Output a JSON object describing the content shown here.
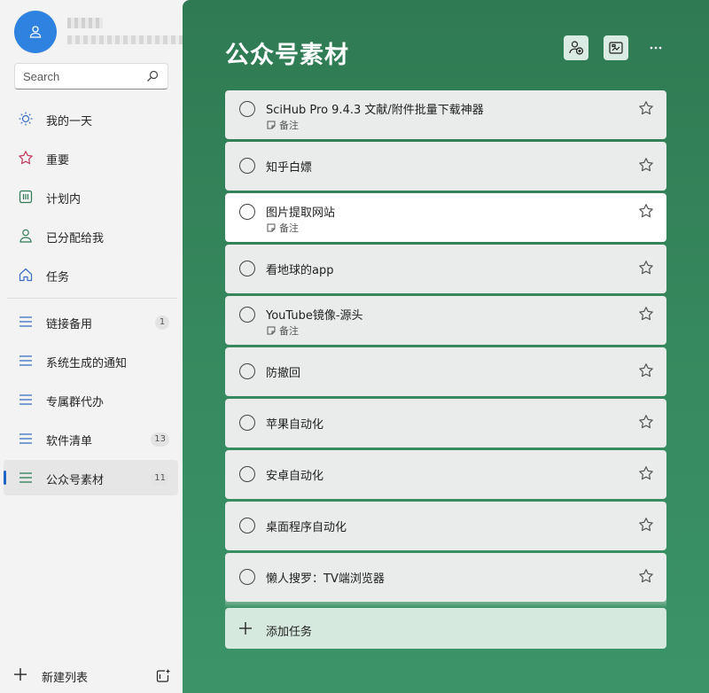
{
  "sidebar": {
    "search_placeholder": "Search",
    "smart_lists": [
      {
        "label": "我的一天",
        "icon": "sun-icon"
      },
      {
        "label": "重要",
        "icon": "star-icon"
      },
      {
        "label": "计划内",
        "icon": "calendar-icon"
      },
      {
        "label": "已分配给我",
        "icon": "person-icon"
      },
      {
        "label": "任务",
        "icon": "home-icon"
      }
    ],
    "lists": [
      {
        "label": "链接备用",
        "count": "1"
      },
      {
        "label": "系统生成的通知",
        "count": ""
      },
      {
        "label": "专属群代办",
        "count": ""
      },
      {
        "label": "软件清单",
        "count": "13"
      },
      {
        "label": "公众号素材",
        "count": "11"
      }
    ],
    "new_list_label": "新建列表"
  },
  "main": {
    "title": "公众号素材",
    "note_label": "备注",
    "tasks": [
      {
        "name": "SciHub Pro 9.4.3 文献/附件批量下载神器",
        "has_note": true
      },
      {
        "name": "知乎白嫖",
        "has_note": false
      },
      {
        "name": "图片提取网站",
        "has_note": true
      },
      {
        "name": "看地球的app",
        "has_note": false
      },
      {
        "name": "YouTube镜像-源头",
        "has_note": true
      },
      {
        "name": "防撤回",
        "has_note": false
      },
      {
        "name": "苹果自动化",
        "has_note": false
      },
      {
        "name": "安卓自动化",
        "has_note": false
      },
      {
        "name": "桌面程序自动化",
        "has_note": false
      },
      {
        "name": "懒人搜罗：TV端浏览器",
        "has_note": false
      }
    ],
    "add_task_label": "添加任务"
  },
  "colors": {
    "accent_green": "#36875d",
    "avatar_blue": "#2f82e0",
    "active_indicator": "#1f63c8"
  }
}
